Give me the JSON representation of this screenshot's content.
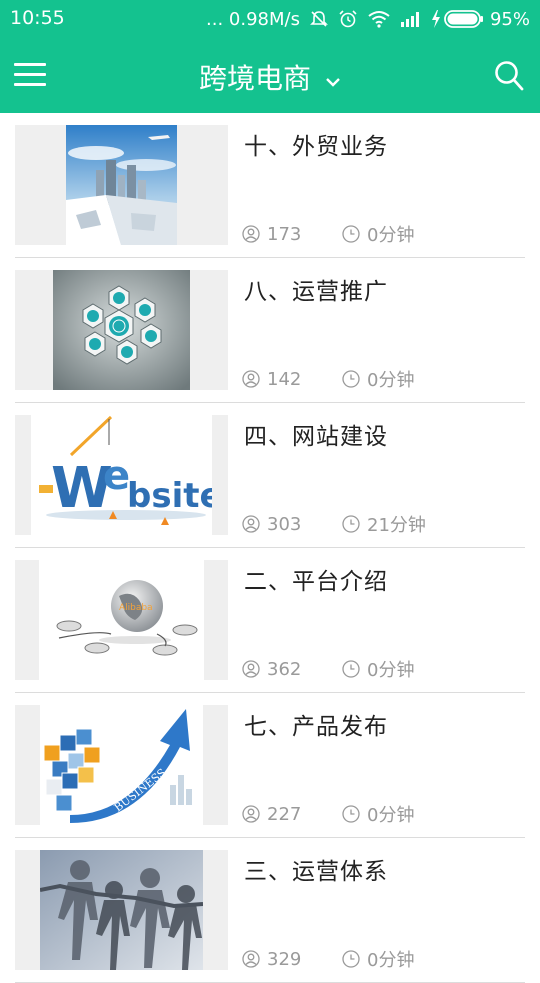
{
  "status_bar": {
    "time": "10:55",
    "speed": "... 0.98M/s",
    "battery": "95%",
    "icons": [
      "mute-icon",
      "alarm-icon",
      "wifi-icon",
      "signal-icon",
      "charging-icon",
      "battery-icon"
    ]
  },
  "app_bar": {
    "title": "跨境电商",
    "icons": [
      "menu-icon",
      "chevron-down-icon",
      "search-icon"
    ]
  },
  "colors": {
    "accent": "#14c28f",
    "text": "#222222",
    "meta": "#9a9a9a",
    "divider": "#dcdcdc"
  },
  "items": [
    {
      "title": "十、外贸业务",
      "views": "173",
      "duration": "0分钟",
      "thumb": "airplane-city-thumbnail"
    },
    {
      "title": "八、运营推广",
      "views": "142",
      "duration": "0分钟",
      "thumb": "hexagon-infographic-thumbnail"
    },
    {
      "title": "四、网站建设",
      "views": "303",
      "duration": "21分钟",
      "thumb": "website-letters-thumbnail"
    },
    {
      "title": "二、平台介绍",
      "views": "362",
      "duration": "0分钟",
      "thumb": "globe-mouse-thumbnail"
    },
    {
      "title": "七、产品发布",
      "views": "227",
      "duration": "0分钟",
      "thumb": "business-arrow-cubes-thumbnail"
    },
    {
      "title": "三、运营体系",
      "views": "329",
      "duration": "0分钟",
      "thumb": "paper-people-thumbnail"
    }
  ]
}
